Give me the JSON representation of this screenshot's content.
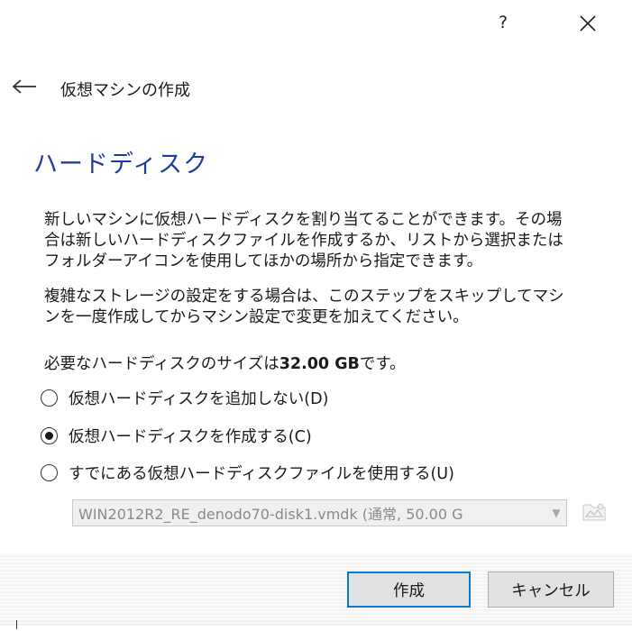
{
  "titlebar": {
    "help_label": "?",
    "close_icon": "close-icon"
  },
  "header": {
    "back_icon": "back-arrow-icon",
    "title": "仮想マシンの作成"
  },
  "section": {
    "heading": "ハードディスク"
  },
  "description": {
    "paragraph1": "新しいマシンに仮想ハードディスクを割り当てることができます。その場\n合は新しいハードディスクファイルを作成するか、リストから選択または\nフォルダーアイコンを使用してほかの場所から指定できます。",
    "paragraph2": "複雑なストレージの設定をする場合は、このステップをスキップしてマシ\nンを一度作成してからマシン設定で変更を加えてください。",
    "size_prefix": "必要なハードディスクのサイズは",
    "size_value": "32.00 GB",
    "size_suffix": "です。"
  },
  "options": [
    {
      "label": "仮想ハードディスクを追加しない(D)",
      "selected": false
    },
    {
      "label": "仮想ハードディスクを作成する(C)",
      "selected": true
    },
    {
      "label": "すでにある仮想ハードディスクファイルを使用する(U)",
      "selected": false
    }
  ],
  "existing_disk": {
    "value": "WIN2012R2_RE_denodo70-disk1.vmdk (通常, 50.00 G",
    "enabled": false,
    "folder_icon": "folder-icon"
  },
  "buttons": {
    "create": "作成",
    "cancel": "キャンセル"
  },
  "colors": {
    "heading": "#1e3c9c",
    "primary_border": "#0a78d7"
  }
}
